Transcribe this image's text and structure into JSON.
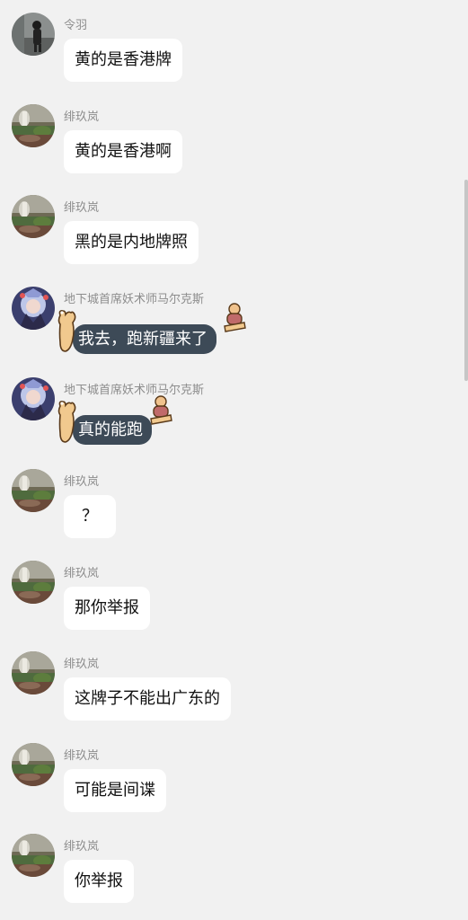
{
  "messages": [
    {
      "sender": "令羽",
      "text": "黄的是香港牌",
      "avatar": "user-photo-icon"
    },
    {
      "sender": "绯玖岚",
      "text": "黄的是香港啊",
      "avatar": "landscape-avatar-icon"
    },
    {
      "sender": "绯玖岚",
      "text": "黑的是内地牌照",
      "avatar": "landscape-avatar-icon"
    },
    {
      "sender": "地下城首席妖术师马尔克斯",
      "text": "我去，跑新疆来了",
      "avatar": "anime-avatar-icon",
      "bubble_style": "decorated-dark"
    },
    {
      "sender": "地下城首席妖术师马尔克斯",
      "text": "真的能跑",
      "avatar": "anime-avatar-icon",
      "bubble_style": "decorated-dark"
    },
    {
      "sender": "绯玖岚",
      "text": "？",
      "avatar": "landscape-avatar-icon"
    },
    {
      "sender": "绯玖岚",
      "text": "那你举报",
      "avatar": "landscape-avatar-icon"
    },
    {
      "sender": "绯玖岚",
      "text": "这牌子不能出广东的",
      "avatar": "landscape-avatar-icon"
    },
    {
      "sender": "绯玖岚",
      "text": "可能是间谍",
      "avatar": "landscape-avatar-icon"
    },
    {
      "sender": "绯玖岚",
      "text": "你举报",
      "avatar": "landscape-avatar-icon"
    }
  ],
  "colors": {
    "background": "#f1f1f1",
    "bubble": "#ffffff",
    "decorated_bubble": "#3d4a57",
    "name_text": "#8d8d8d"
  }
}
